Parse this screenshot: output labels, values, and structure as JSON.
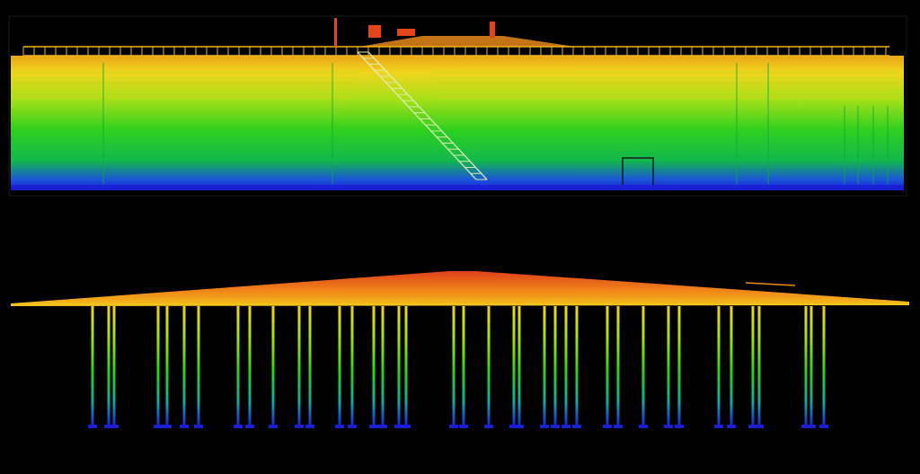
{
  "scene": {
    "kind": "lidar-point-cloud-render",
    "color_ramp": [
      "#1a1fd6",
      "#1b6fe0",
      "#16c84a",
      "#36d51c",
      "#a6e214",
      "#f3d41a",
      "#f49316",
      "#e2451a"
    ],
    "background": "#000000",
    "views": [
      {
        "name": "tank-side-elevation",
        "description_visible": false
      },
      {
        "name": "tank-floor-support-columns",
        "description_visible": false
      }
    ]
  }
}
